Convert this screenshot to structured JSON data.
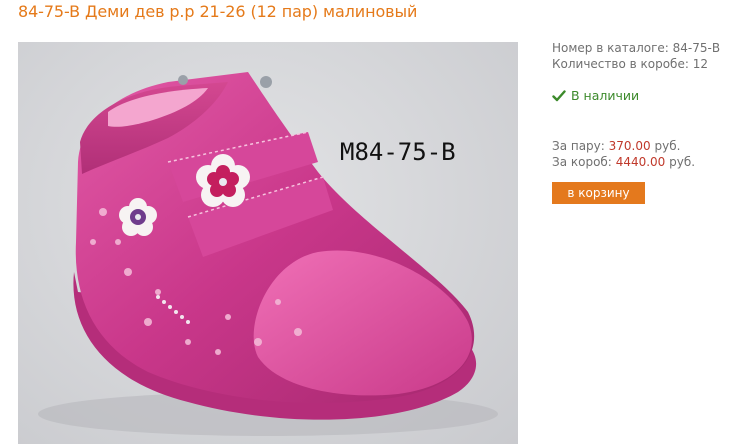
{
  "product": {
    "title": "84-75-B Деми дев р.р 21-26 (12 пар) малиновый",
    "photo_label": "M84-75-B"
  },
  "info": {
    "catalog_label": "Номер в каталоге:",
    "catalog_value": "84-75-B",
    "box_qty_label": "Количество в коробе:",
    "box_qty_value": "12",
    "stock_text": "В наличии"
  },
  "pricing": {
    "pair_label": "За пару:",
    "pair_price": "370.00",
    "box_label": "За короб:",
    "box_price": "4440.00",
    "currency": "руб."
  },
  "actions": {
    "cart_label": "в корзину"
  },
  "colors": {
    "title": "#e57a1a",
    "button": "#e4791d",
    "price": "#c0392b",
    "stock": "#3c8a2b"
  }
}
